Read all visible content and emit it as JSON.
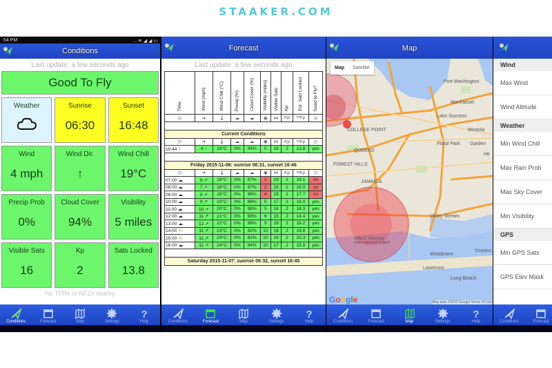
{
  "brand": "STAAKER.COM",
  "status_time": ":54 PM",
  "status_icons": "... ≋ ◢ ◢ ▭",
  "colors": {
    "green": "#6cf66c",
    "yellow": "#ffff22",
    "red": "#ef6f6f",
    "blue_bar": "#2a53d6",
    "brand": "#4fc9d9"
  },
  "tabs": [
    {
      "label": "Conditions",
      "icon": "paper-plane-icon"
    },
    {
      "label": "Forecast",
      "icon": "calendar-icon"
    },
    {
      "label": "Map",
      "icon": "map-icon"
    },
    {
      "label": "Settings",
      "icon": "gear-icon"
    },
    {
      "label": "Help",
      "icon": "question-icon"
    }
  ],
  "conditions": {
    "title": "Conditions",
    "last_update": "Last update: a few seconds ago",
    "verdict": "Good To Fly",
    "cells": [
      {
        "label": "Weather",
        "value": "",
        "color": "blue",
        "icon": "cloud-icon"
      },
      {
        "label": "Sunrise",
        "value": "06:30",
        "color": "yellow"
      },
      {
        "label": "Sunset",
        "value": "16:48",
        "color": "yellow"
      },
      {
        "label": "Wind",
        "value": "4 mph",
        "color": "green"
      },
      {
        "label": "Wind Dir.",
        "value": "↑",
        "color": "green"
      },
      {
        "label": "Wind Chill",
        "value": "19°C",
        "color": "green"
      },
      {
        "label": "Precip Prob",
        "value": "0%",
        "color": "green"
      },
      {
        "label": "Cloud Cover",
        "value": "94%",
        "color": "green"
      },
      {
        "label": "Visibility",
        "value": "5 miles",
        "color": "green"
      },
      {
        "label": "Visible Sats",
        "value": "16",
        "color": "green"
      },
      {
        "label": "Kp",
        "value": "2",
        "color": "green"
      },
      {
        "label": "Sats Locked",
        "value": "13.8",
        "color": "green"
      }
    ],
    "note": "No TFRs or NFZs nearby"
  },
  "forecast": {
    "title": "Forecast",
    "last_update": "Last update: a few seconds ago",
    "columns": [
      "Time",
      "Wind (mph)",
      "Wind Chill (°C)",
      "Precip (%)",
      "Cloud Cover (%)",
      "Visibility (miles)",
      "Visible Sats",
      "Kp",
      "Est. Sats Locked",
      "Good to Fly?"
    ],
    "column_icons": [
      "◷",
      "➜",
      "🌡",
      "☁",
      "☁",
      "◉",
      "⋈",
      "Kp",
      "ʷᵗKp",
      "◷"
    ],
    "current_title": "Current Conditions",
    "current_row": {
      "time": "19:44 ☾",
      "cells": [
        "4 ↑",
        "19°C",
        "0%",
        "94%",
        "5",
        "16",
        "2",
        "13.8",
        "yes"
      ],
      "flags": [
        "g",
        "g",
        "g",
        "g",
        "g",
        "g",
        "g",
        "g",
        "g"
      ]
    },
    "day1_title": "Friday 2015-11-06: sunrise 06:31, sunset 16:46",
    "day1_rows": [
      {
        "time": "07:00 ☁",
        "cells": [
          "6 ↗",
          "18°C",
          "0%",
          "97%",
          "1",
          "19",
          "1",
          "18.1",
          "no"
        ],
        "flags": [
          "g",
          "g",
          "g",
          "g",
          "r",
          "g",
          "g",
          "g",
          "r"
        ]
      },
      {
        "time": "08:00 ☁",
        "cells": [
          "7 ↗",
          "18°C",
          "0%",
          "97%",
          "2",
          "19",
          "1",
          "18.0",
          "no"
        ],
        "flags": [
          "g",
          "g",
          "g",
          "g",
          "r",
          "g",
          "g",
          "g",
          "r"
        ]
      },
      {
        "time": "09:00 ☁",
        "cells": [
          "9 ↗",
          "18°C",
          "0%",
          "98%",
          "4",
          "19",
          "1",
          "17.7",
          "no"
        ],
        "flags": [
          "g",
          "g",
          "g",
          "g",
          "r",
          "g",
          "g",
          "g",
          "r"
        ]
      },
      {
        "time": "10:00 ☁",
        "cells": [
          "9 ↗",
          "19°C",
          "0%",
          "98%",
          "5",
          "17",
          "2",
          "16.0",
          "yes"
        ],
        "flags": [
          "g",
          "g",
          "g",
          "g",
          "g",
          "g",
          "g",
          "g",
          "g"
        ]
      },
      {
        "time": "11:00 ☁",
        "cells": [
          "10 ↗",
          "20°C",
          "0%",
          "98%",
          "5",
          "18",
          "2",
          "16.3",
          "yes"
        ],
        "flags": [
          "g",
          "g",
          "g",
          "g",
          "g",
          "g",
          "g",
          "g",
          "g"
        ]
      },
      {
        "time": "12:00 ☁",
        "cells": [
          "11 ↗",
          "21°C",
          "0%",
          "98%",
          "6",
          "15",
          "2",
          "14.4",
          "yes"
        ],
        "flags": [
          "g",
          "g",
          "g",
          "g",
          "g",
          "g",
          "g",
          "g",
          "g"
        ]
      },
      {
        "time": "13:00 ☁",
        "cells": [
          "12 ↗",
          "22°C",
          "0%",
          "98%",
          "9",
          "18",
          "2",
          "16.2",
          "yes"
        ],
        "flags": [
          "g",
          "g",
          "g",
          "g",
          "g",
          "g",
          "g",
          "g",
          "g"
        ]
      },
      {
        "time": "14:00 ⛅",
        "cells": [
          "11 ↗",
          "23°C",
          "0%",
          "92%",
          "10",
          "18",
          "2",
          "16.8",
          "yes"
        ],
        "flags": [
          "g",
          "g",
          "g",
          "g",
          "g",
          "g",
          "g",
          "g",
          "g"
        ]
      },
      {
        "time": "15:00 ⛅",
        "cells": [
          "11 ↗",
          "24°C",
          "0%",
          "91%",
          "10",
          "16",
          "2",
          "15.3",
          "yes"
        ],
        "flags": [
          "g",
          "g",
          "g",
          "g",
          "g",
          "g",
          "g",
          "g",
          "g"
        ]
      },
      {
        "time": "16:00 ☁",
        "cells": [
          "11 ↗",
          "24°C",
          "0%",
          "94%",
          "10",
          "17",
          "2",
          "15.9",
          "yes"
        ],
        "flags": [
          "g",
          "g",
          "g",
          "g",
          "g",
          "g",
          "g",
          "g",
          "g"
        ]
      }
    ],
    "day2_title": "Saturday 2015-11-07: sunrise 06:32, sunset 16:45"
  },
  "map": {
    "title": "Map",
    "type_map": "Map",
    "type_satellite": "Satellite",
    "labels": [
      "Port Washington",
      "Manhasset",
      "Lake Success",
      "QUEENS",
      "Floral Park",
      "Mineola",
      "Garden",
      "He",
      "FOREST HILLS",
      "JAMAICA",
      "COLLEGE POINT",
      "Valley Stream",
      "John F. Kennedy International Airport",
      "Woodmere",
      "Lawrence",
      "Oceans",
      "Long Beach"
    ],
    "attribution": "Map data ©2015 Google   Terms of Use",
    "google": "Google"
  },
  "settings": {
    "sections": [
      {
        "title": "Wind",
        "items": [
          "Max Wind",
          "Wind Altitude"
        ]
      },
      {
        "title": "Weather",
        "items": [
          "Min Wind Chill",
          "Max Rain Prob",
          "Max Sky Cover",
          "Min Visibility"
        ]
      },
      {
        "title": "GPS",
        "items": [
          "Min GPS Sats",
          "GPS Elev Mask"
        ]
      }
    ]
  }
}
